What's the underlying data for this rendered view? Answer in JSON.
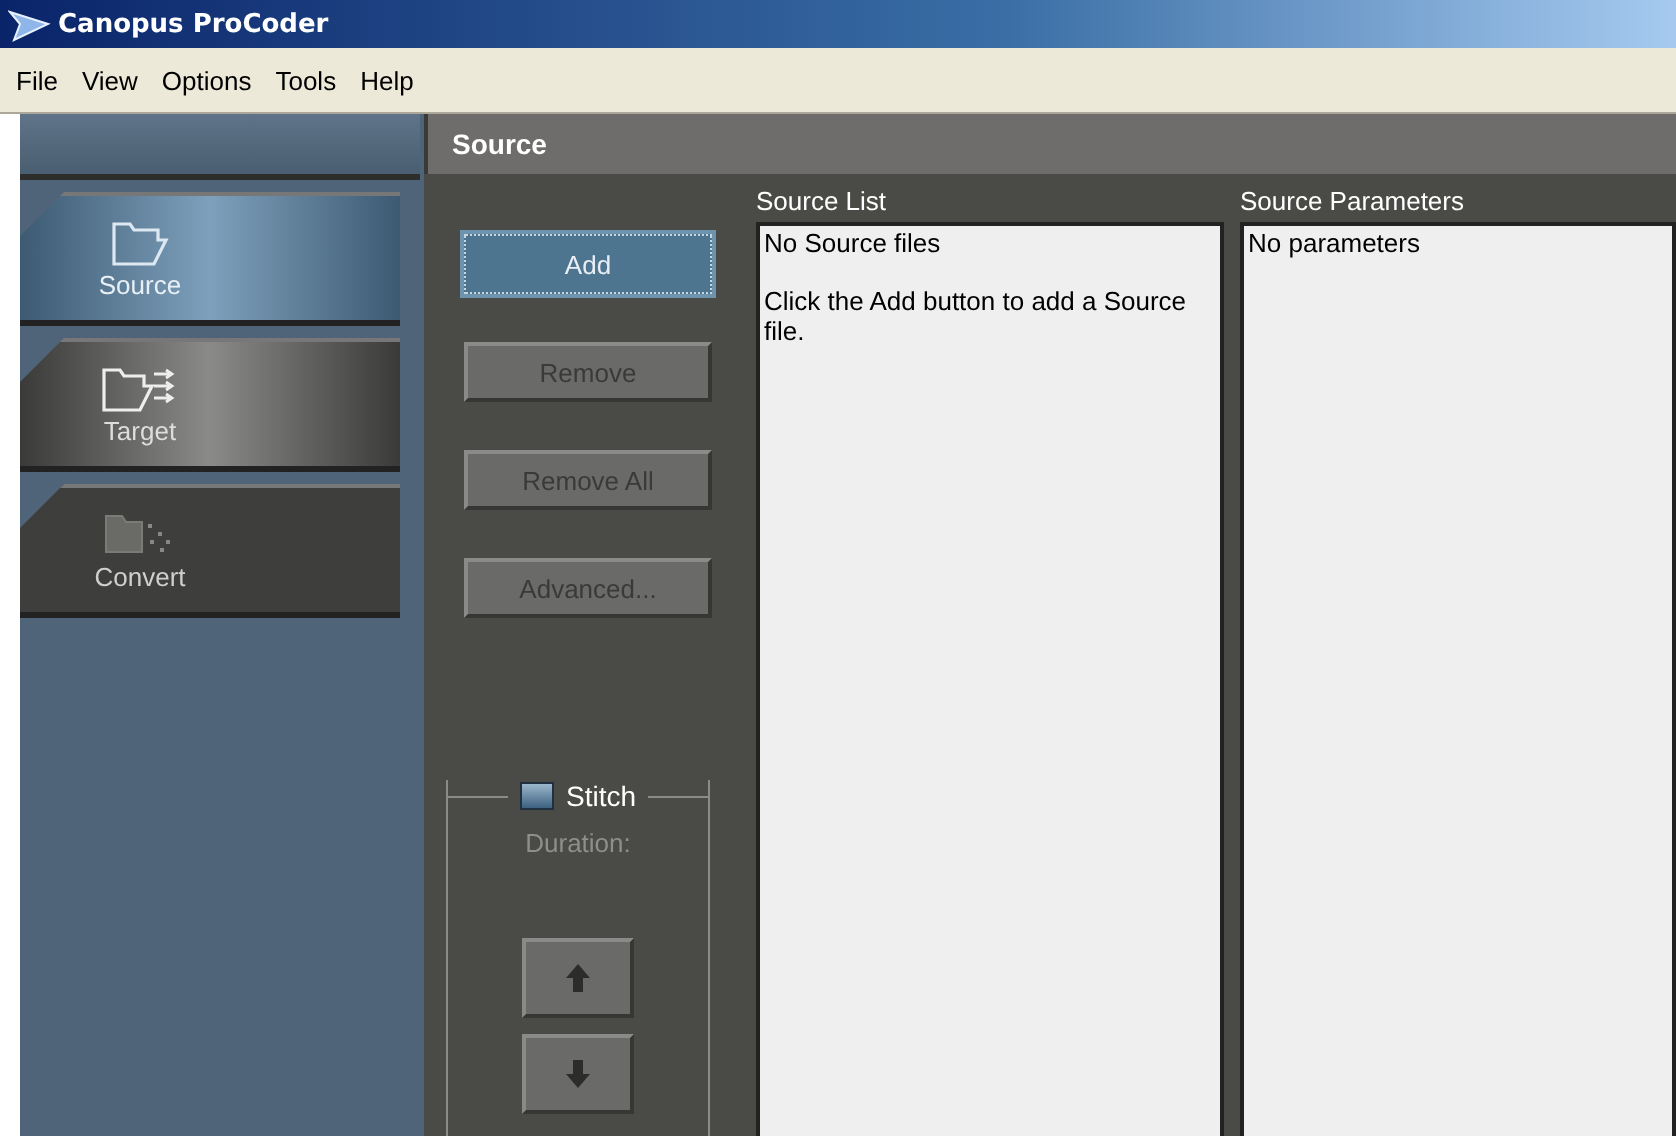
{
  "window": {
    "title": "Canopus ProCoder"
  },
  "menu": [
    "File",
    "View",
    "Options",
    "Tools",
    "Help"
  ],
  "tabs": [
    {
      "label": "Source",
      "kind": "source",
      "selected": true,
      "disabled": false
    },
    {
      "label": "Target",
      "kind": "target",
      "selected": false,
      "disabled": false
    },
    {
      "label": "Convert",
      "kind": "convert",
      "selected": false,
      "disabled": true
    }
  ],
  "section_title": "Source",
  "buttons": [
    {
      "label": "Add",
      "disabled": false
    },
    {
      "label": "Remove",
      "disabled": true
    },
    {
      "label": "Remove All",
      "disabled": true
    },
    {
      "label": "Advanced...",
      "disabled": true
    }
  ],
  "stitch": {
    "label": "Stitch",
    "checked": false,
    "duration_label": "Duration:",
    "duration_disabled": true,
    "move_buttons": [
      {
        "kind": "up"
      },
      {
        "kind": "down"
      }
    ]
  },
  "source_list": {
    "label": "Source List",
    "lines": [
      "No Source files",
      "Click the Add button to add a Source file."
    ]
  },
  "source_parameters": {
    "label": "Source Parameters",
    "lines": [
      "No parameters"
    ]
  }
}
